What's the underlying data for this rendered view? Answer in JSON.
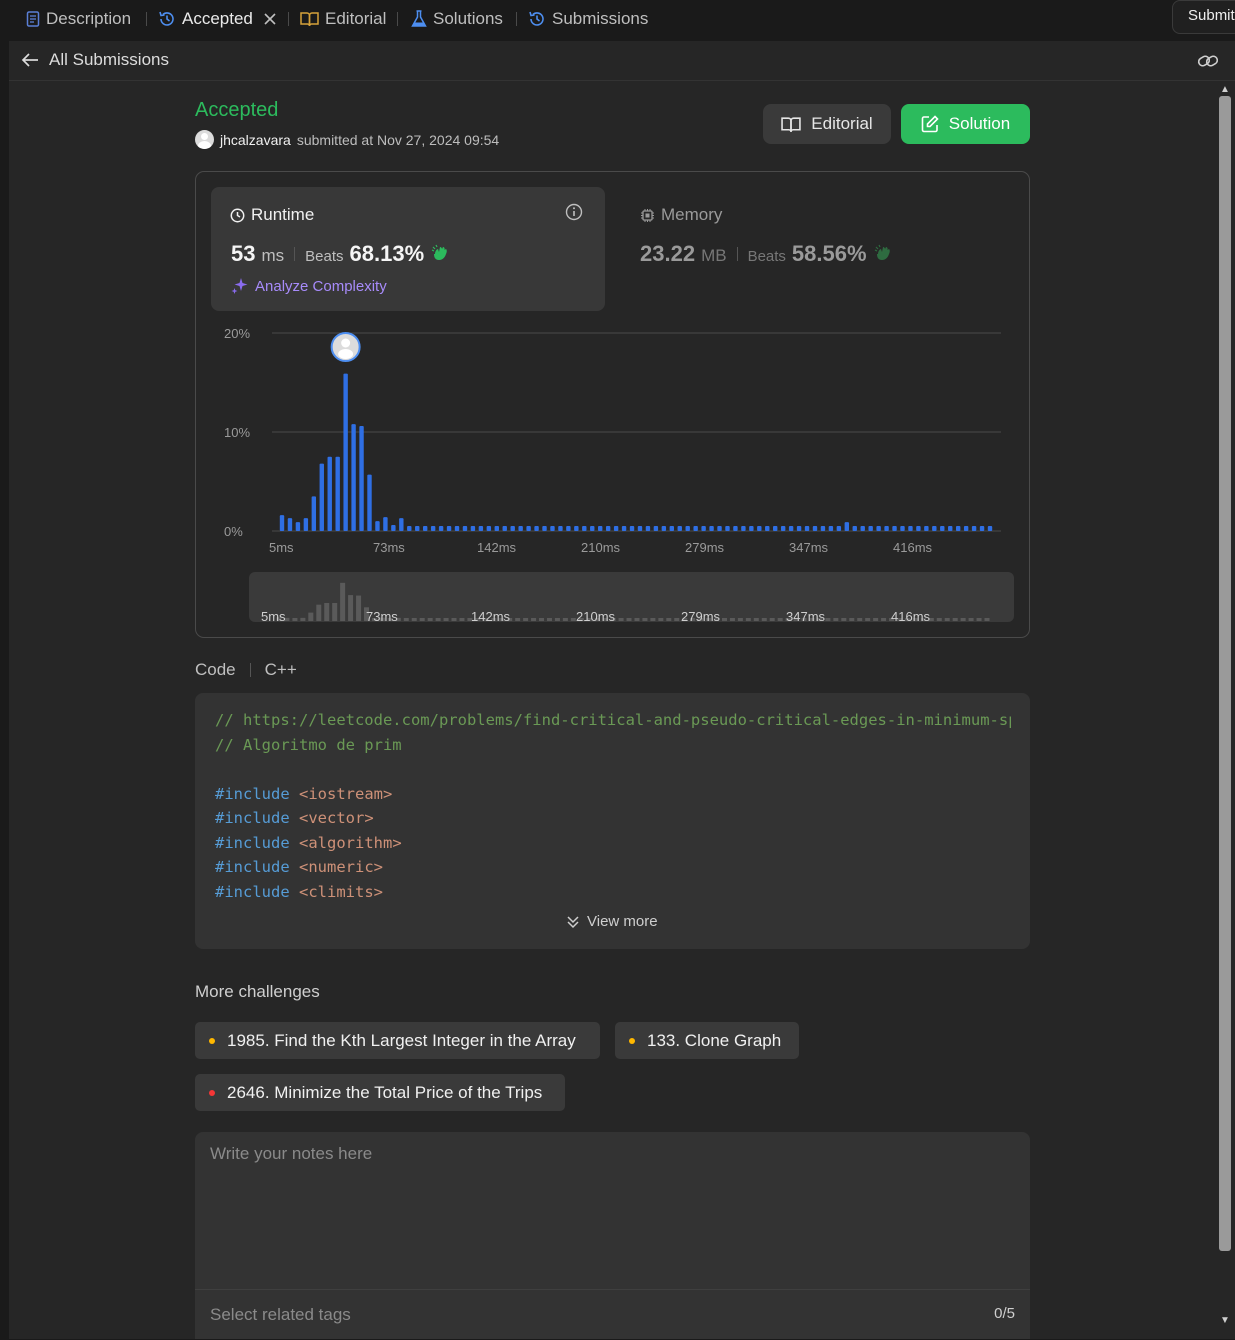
{
  "tabs": [
    {
      "label": "Description",
      "icon": "description-icon"
    },
    {
      "label": "Accepted",
      "icon": "history-icon"
    },
    {
      "label": "Editorial",
      "icon": "book-icon"
    },
    {
      "label": "Solutions",
      "icon": "flask-icon"
    },
    {
      "label": "Submissions",
      "icon": "history-icon"
    }
  ],
  "submit_label": "Submit",
  "header": {
    "back_label": "All Submissions"
  },
  "submission": {
    "status": "Accepted",
    "user": "jhcalzavara",
    "submitted_text": "submitted at Nov 27, 2024 09:54"
  },
  "buttons": {
    "editorial": "Editorial",
    "solution": "Solution"
  },
  "runtime": {
    "label": "Runtime",
    "value": "53",
    "unit": "ms",
    "beats_label": "Beats",
    "beats": "68.13%"
  },
  "memory": {
    "label": "Memory",
    "value": "23.22",
    "unit": "MB",
    "beats_label": "Beats",
    "beats": "58.56%"
  },
  "analyze_label": "Analyze Complexity",
  "chart_data": {
    "type": "bar",
    "y_tick_labels": [
      "20%",
      "10%",
      "0%"
    ],
    "x_tick_labels": [
      "5ms",
      "73ms",
      "142ms",
      "210ms",
      "279ms",
      "347ms",
      "416ms"
    ],
    "ylim": [
      0,
      20
    ],
    "values": [
      1.6,
      1.3,
      0.9,
      1.3,
      3.5,
      6.8,
      7.5,
      7.5,
      15.9,
      10.8,
      10.6,
      5.7,
      1.0,
      1.4,
      0.6,
      1.3,
      0.5,
      0.5,
      0.5,
      0.5,
      0.5,
      0.5,
      0.5,
      0.5,
      0.5,
      0.5,
      0.5,
      0.5,
      0.5,
      0.5,
      0.5,
      0.5,
      0.5,
      0.5,
      0.5,
      0.5,
      0.5,
      0.5,
      0.5,
      0.5,
      0.5,
      0.5,
      0.5,
      0.5,
      0.5,
      0.5,
      0.5,
      0.5,
      0.5,
      0.5,
      0.5,
      0.5,
      0.5,
      0.5,
      0.5,
      0.5,
      0.5,
      0.5,
      0.5,
      0.5,
      0.5,
      0.5,
      0.5,
      0.5,
      0.5,
      0.5,
      0.5,
      0.5,
      0.5,
      0.5,
      0.5,
      0.9,
      0.5,
      0.5,
      0.5,
      0.5,
      0.5,
      0.5,
      0.5,
      0.5,
      0.5,
      0.5,
      0.5,
      0.5,
      0.5,
      0.5,
      0.5,
      0.5,
      0.5,
      0.5
    ],
    "highlight_index": 8,
    "bar_color": "#2f6fe4",
    "overview_color": "#5a5a5a",
    "grid": true
  },
  "code": {
    "header_label": "Code",
    "language": "C++",
    "lines": [
      {
        "type": "comment",
        "text": "// https://leetcode.com/problems/find-critical-and-pseudo-critical-edges-in-minimum-spanning-tree/"
      },
      {
        "type": "comment",
        "text": "// Algoritmo de prim"
      },
      {
        "type": "blank",
        "text": ""
      },
      {
        "type": "include",
        "kw": "#include",
        "arg": "<iostream>"
      },
      {
        "type": "include",
        "kw": "#include",
        "arg": "<vector>"
      },
      {
        "type": "include",
        "kw": "#include",
        "arg": "<algorithm>"
      },
      {
        "type": "include",
        "kw": "#include",
        "arg": "<numeric>"
      },
      {
        "type": "include",
        "kw": "#include",
        "arg": "<climits>"
      }
    ],
    "view_more": "View more"
  },
  "more_challenges": {
    "title": "More challenges",
    "items": [
      {
        "label": "1985. Find the Kth Largest Integer in the Array",
        "dot_color": "#ffb800"
      },
      {
        "label": "133. Clone Graph",
        "dot_color": "#ffb800"
      },
      {
        "label": "2646. Minimize the Total Price of the Trips",
        "dot_color": "#f63636"
      }
    ]
  },
  "notes": {
    "placeholder": "Write your notes here",
    "tags_placeholder": "Select related tags",
    "tags_count": "0/5"
  }
}
